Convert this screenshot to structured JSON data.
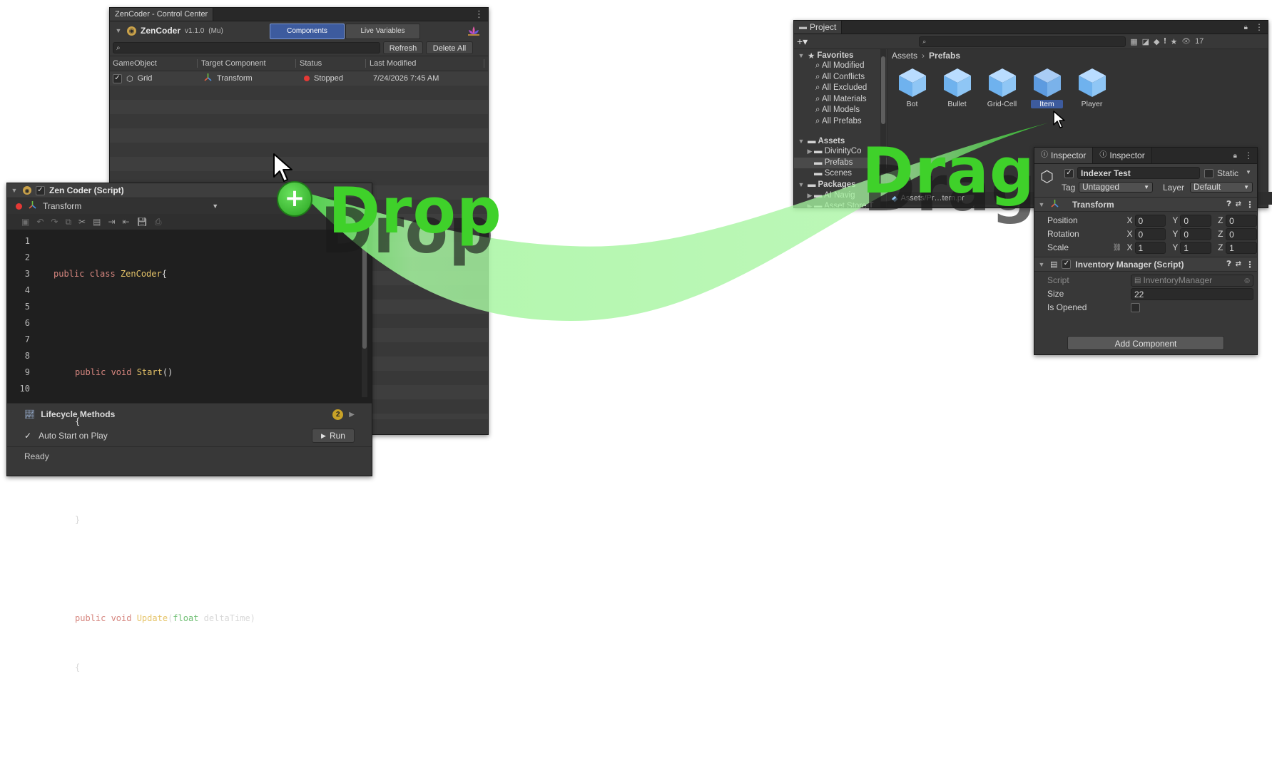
{
  "control_center": {
    "window_title": "ZenCoder - Control Center",
    "app_name": "ZenCoder",
    "version": "v1.1.0",
    "mode": "(Mu)",
    "tab_components": "Components",
    "tab_live_variables": "Live Variables",
    "refresh_label": "Refresh",
    "delete_all_label": "Delete All",
    "columns": [
      "GameObject",
      "Target Component",
      "Status",
      "Last Modified"
    ],
    "rows": [
      {
        "gameobject": "Grid",
        "component": "Transform",
        "status": "Stopped",
        "modified": "7/24/2026 7:45 AM",
        "status_color": "#e53935"
      }
    ]
  },
  "script_panel": {
    "title": "Zen Coder (Script)",
    "target": "Transform",
    "line_numbers": [
      "1",
      "2",
      "3",
      "4",
      "5",
      "6",
      "7",
      "8",
      "9",
      "10"
    ],
    "code": {
      "l1_kw": "public class ",
      "l1_name": "ZenCoder",
      "l1_end": "{",
      "l3_kw": "public void ",
      "l3_name": "Start",
      "l3_end": "()",
      "l4": "{",
      "l6": "}",
      "l8_kw": "public void ",
      "l8_name": "Update",
      "l8_paren": "(",
      "l8_type": "float",
      "l8_arg": " deltaTime)",
      "l9": "{"
    },
    "lifecycle_label": "Lifecycle Methods",
    "lifecycle_count": "2",
    "auto_start_label": "Auto Start on Play",
    "run_label": "Run",
    "status": "Ready"
  },
  "project": {
    "tab": "Project",
    "badge_count": "17",
    "favorites_label": "Favorites",
    "favorites": [
      "All Modified",
      "All Conflicts",
      "All Excluded",
      "All Materials",
      "All Models",
      "All Prefabs"
    ],
    "assets_label": "Assets",
    "asset_folders": [
      "DivinityCo",
      "Prefabs",
      "Scenes"
    ],
    "packages_label": "Packages",
    "package_items": [
      "AI Navig",
      "Asset Store T"
    ],
    "breadcrumb_root": "Assets",
    "breadcrumb_current": "Prefabs",
    "prefabs": [
      "Bot",
      "Bullet",
      "Grid-Cell",
      "Item",
      "Player"
    ],
    "selected_prefab": "Item",
    "footer_path": "Assets/Pr…tem.pr"
  },
  "inspector": {
    "tab1": "Inspector",
    "tab2": "Inspector",
    "object_name": "Indexer Test",
    "static_label": "Static",
    "tag_label": "Tag",
    "tag_value": "Untagged",
    "layer_label": "Layer",
    "layer_value": "Default",
    "transform_title": "Transform",
    "position_label": "Position",
    "rotation_label": "Rotation",
    "scale_label": "Scale",
    "axis_x": "X",
    "axis_y": "Y",
    "axis_z": "Z",
    "position": [
      "0",
      "0",
      "0"
    ],
    "rotation": [
      "0",
      "0",
      "0"
    ],
    "scale": [
      "1",
      "1",
      "1"
    ],
    "script_component_title": "Inventory Manager (Script)",
    "script_label": "Script",
    "script_value": "InventoryManager",
    "size_label": "Size",
    "size_value": "22",
    "is_opened_label": "Is Opened",
    "add_component_label": "Add Component"
  },
  "overlay": {
    "drop_label": "Drop",
    "drag_label": "Drag",
    "plus_symbol": "+"
  },
  "colors": {
    "accent_green": "#3fd12a",
    "selection_blue": "#3d5b9e",
    "code_keyword": "#d6867f",
    "code_name": "#e6c469",
    "code_type": "#6fbf73"
  }
}
